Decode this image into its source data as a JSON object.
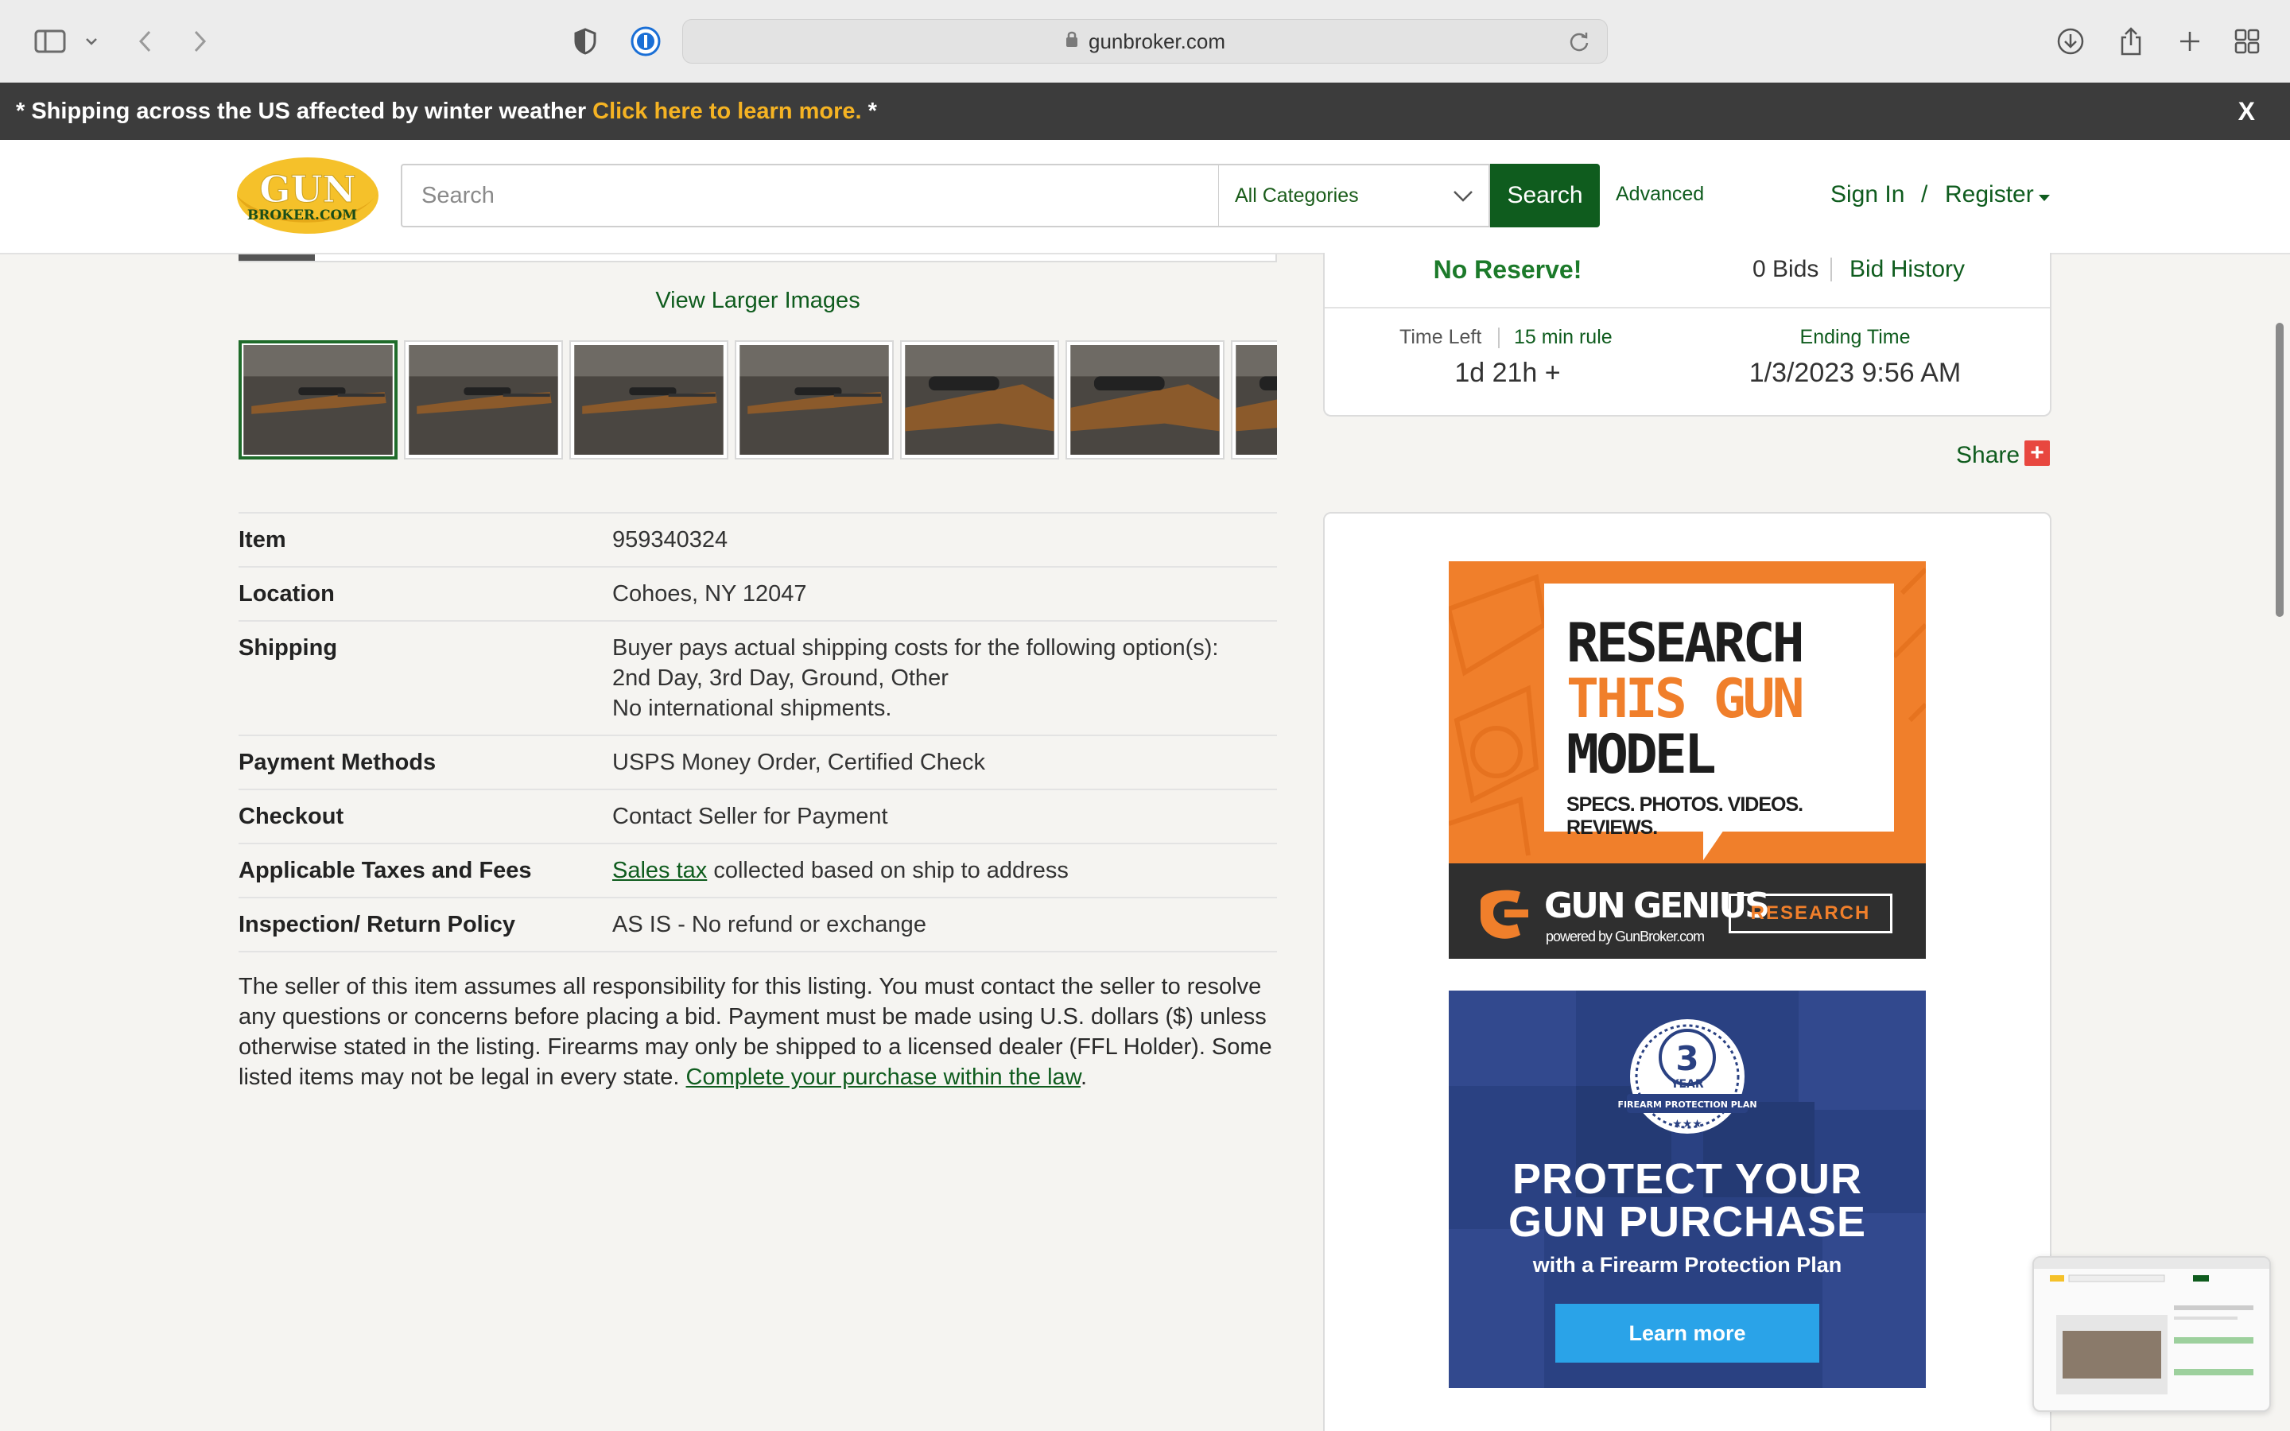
{
  "browser": {
    "url": "gunbroker.com"
  },
  "notice": {
    "text": "* Shipping across the US affected by winter weather",
    "link": "Click here to learn more.",
    "tail": "*",
    "close": "X"
  },
  "header": {
    "logo_top": "GUN",
    "logo_bottom": "BROKER.COM",
    "search_placeholder": "Search",
    "category": "All Categories",
    "search_button": "Search",
    "advanced": "Advanced",
    "sign_in": "Sign In",
    "slash": "/",
    "register": "Register"
  },
  "gallery": {
    "view_larger": "View Larger Images",
    "thumbnail_count": 7,
    "selected_index": 0
  },
  "details": [
    {
      "label": "Item",
      "value": [
        "959340324"
      ]
    },
    {
      "label": "Location",
      "value": [
        "Cohoes, NY 12047"
      ]
    },
    {
      "label": "Shipping",
      "value": [
        "Buyer pays actual shipping costs for the following option(s):",
        "2nd Day, 3rd Day, Ground, Other",
        "No international shipments."
      ]
    },
    {
      "label": "Payment Methods",
      "value": [
        "USPS Money Order, Certified Check"
      ]
    },
    {
      "label": "Checkout",
      "value": [
        "Contact Seller for Payment"
      ]
    },
    {
      "label": "Applicable Taxes and Fees",
      "link": "Sales tax",
      "value": [
        " collected based on ship to address"
      ]
    },
    {
      "label": "Inspection/ Return Policy",
      "value": [
        "AS IS - No refund or exchange"
      ]
    }
  ],
  "disclaimer": {
    "text": "The seller of this item assumes all responsibility for this listing. You must contact the seller to resolve any questions or concerns before placing a bid. Payment must be made using U.S. dollars ($) unless otherwise stated in the listing. Firearms may only be shipped to a licensed dealer (FFL Holder). Some listed items may not be legal in every state. ",
    "link": "Complete your purchase within the law",
    "end": "."
  },
  "bid": {
    "no_reserve": "No Reserve!",
    "bids": "0 Bids",
    "bid_history": "Bid History",
    "time_left_label": "Time Left",
    "rule_link": "15 min rule",
    "time_left_value": "1d 21h +",
    "ending_label": "Ending Time",
    "ending_value": "1/3/2023 9:56 AM"
  },
  "share": {
    "label": "Share",
    "icon": "+"
  },
  "ad1": {
    "line1": "RESEARCH",
    "line2": "THIS GUN",
    "line3": "MODEL",
    "sub": "SPECS. PHOTOS. VIDEOS. REVIEWS.",
    "brand": "GUN GENIUS",
    "brand_sub": "powered by GunBroker.com",
    "button": "RESEARCH",
    "colors": {
      "orange": "#f07f2b",
      "dark": "#2f2f2f"
    }
  },
  "ad2": {
    "badge_number": "3",
    "badge_year": "YEAR",
    "badge_text": "FIREARM PROTECTION PLAN",
    "title_line1": "PROTECT YOUR",
    "title_line2": "GUN PURCHASE",
    "sub": "with a Firearm Protection Plan",
    "button": "Learn more",
    "colors": {
      "navy": "#2a4182",
      "button": "#2aa3e8"
    }
  },
  "colors": {
    "brand_green": "#0f5c1e",
    "accent_yellow": "#f5b323",
    "no_reserve_green": "#1c7a2a",
    "share_red": "#e8473f"
  }
}
